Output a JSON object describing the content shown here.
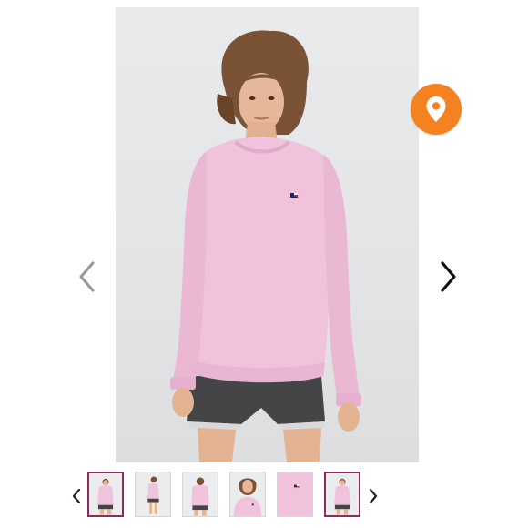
{
  "gallery": {
    "current_index": 1,
    "thumbnail_count": 6,
    "active_thumbnails": [
      1,
      6
    ],
    "icons": {
      "prev": "chevron-left-icon",
      "next": "chevron-right-icon",
      "location": "map-pin-icon"
    },
    "colors": {
      "sweater": "#f0c2dc",
      "location_badge": "#f58220",
      "active_thumb_border": "#8e2a5c",
      "background": "#e5e6e8"
    }
  }
}
